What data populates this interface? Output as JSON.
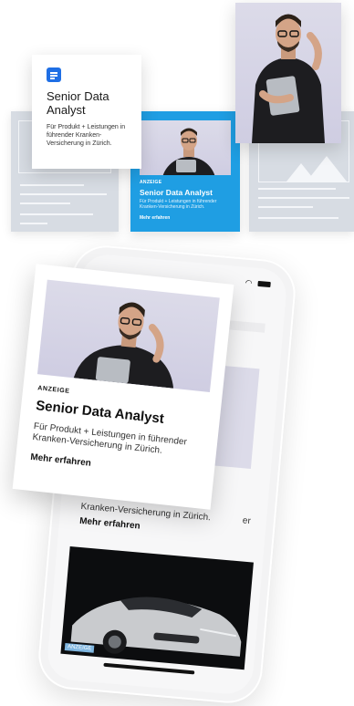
{
  "doc_card": {
    "title": "Senior Data Analyst",
    "description": "Für Produkt + Leistungen in führender Kranken-Versicherung in Zürich."
  },
  "blue_card": {
    "tag": "ANZEIGE",
    "title": "Senior Data Analyst",
    "description": "Für Produkt + Leistungen in führender Kranken-Versicherung in Zürich.",
    "cta": "Mehr erfahren"
  },
  "ad_card": {
    "tag": "ANZEIGE",
    "title": "Senior Data Analyst",
    "description": "Für Produkt + Leistungen in führender Kranken-Versicherung in Zürich.",
    "cta": "Mehr erfahren"
  },
  "phone": {
    "text_fragment": "Kranken-Versicherung in Zürich.",
    "text_fragment_suffix": "er",
    "cta": "Mehr erfahren",
    "car_ad_tag": "ANZEIGE"
  },
  "colors": {
    "accent_blue": "#1f9ee3",
    "icon_blue": "#1f6fe5",
    "tile_gray": "#d7dce3"
  }
}
